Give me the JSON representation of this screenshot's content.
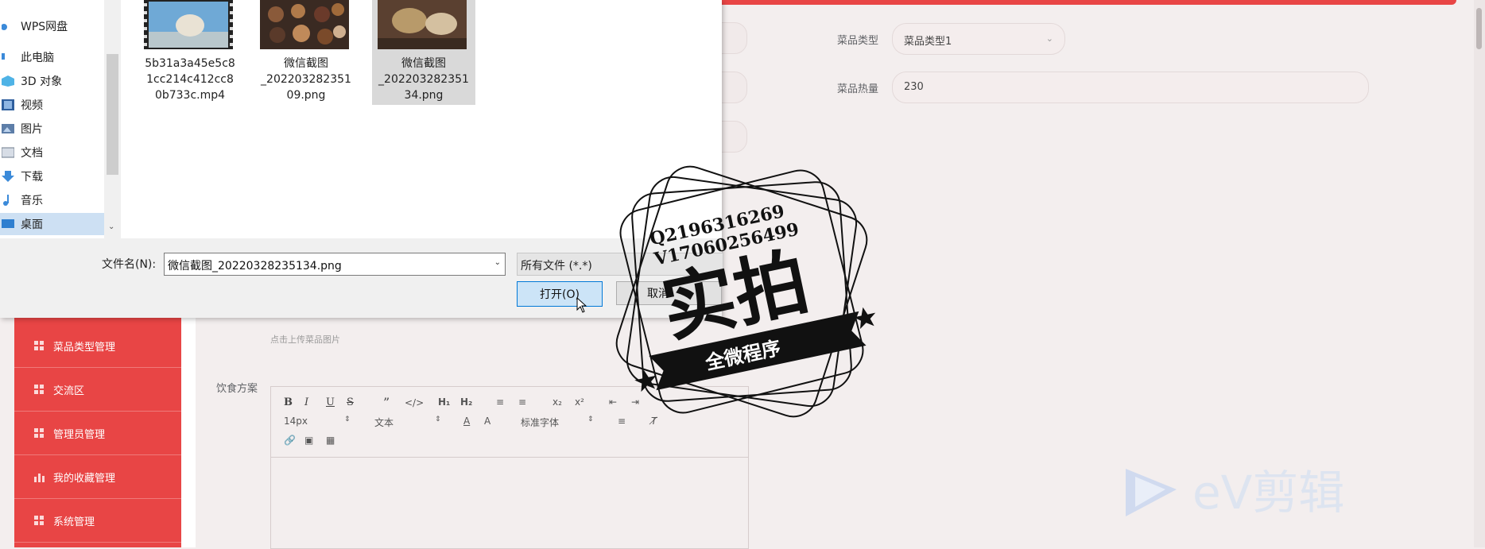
{
  "form": {
    "type_label": "菜品类型",
    "type_value": "菜品类型1",
    "calorie_label": "菜品热量",
    "calorie_value": "230",
    "upload_hint": "点击上传菜品图片",
    "diet_label": "饮食方案"
  },
  "editor": {
    "font_size": "14px",
    "paragraph": "文本",
    "font_family": "标准字体"
  },
  "sidebar": {
    "items": [
      {
        "label": "菜品类型管理",
        "icon": "grid-icon"
      },
      {
        "label": "交流区",
        "icon": "grid-icon"
      },
      {
        "label": "管理员管理",
        "icon": "grid-icon"
      },
      {
        "label": "我的收藏管理",
        "icon": "bar-chart-icon"
      },
      {
        "label": "系统管理",
        "icon": "grid-icon"
      }
    ]
  },
  "dialog": {
    "nav": [
      {
        "label": "WPS网盘",
        "icon": "cloud-icon"
      },
      {
        "label": "此电脑",
        "icon": "computer-icon"
      },
      {
        "label": "3D 对象",
        "icon": "cube-icon"
      },
      {
        "label": "视频",
        "icon": "video-icon"
      },
      {
        "label": "图片",
        "icon": "picture-icon"
      },
      {
        "label": "文档",
        "icon": "document-icon"
      },
      {
        "label": "下载",
        "icon": "download-icon"
      },
      {
        "label": "音乐",
        "icon": "music-icon"
      },
      {
        "label": "桌面",
        "icon": "desktop-icon"
      }
    ],
    "files": [
      {
        "line1": "5b31a3a45e5c8",
        "line2": "1cc214c412cc8",
        "line3": "0b733c.mp4"
      },
      {
        "line1": "微信截图",
        "line2": "_202203282351",
        "line3": "09.png"
      },
      {
        "line1": "微信截图",
        "line2": "_202203282351",
        "line3": "34.png"
      }
    ],
    "filename_label": "文件名(N):",
    "filename_value": "微信截图_20220328235134.png",
    "filetype_value": "所有文件 (*.*)",
    "open_label": "打开(O)",
    "cancel_label": "取消"
  },
  "watermark": {
    "qq": "Q2196316269",
    "wechat": "V17060256499",
    "big_text": "实拍",
    "banner": "全微程序",
    "ev_text": "eV剪辑"
  },
  "colors": {
    "sidebar": "#e84545",
    "page_bg": "#f3eeee",
    "dialog_bg": "#f0f0f0",
    "selection": "#cde0f3",
    "primary_button": "#cce4f7"
  }
}
